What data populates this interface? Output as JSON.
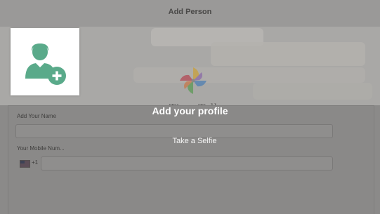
{
  "nav": {
    "title": "Add Person"
  },
  "banner": {
    "logo_text": "TippyTalk",
    "logo_icon": "pinwheel-logo-icon"
  },
  "avatar": {
    "icon": "add-person-icon",
    "accent_color": "#5aaa8a"
  },
  "form": {
    "name_label": "Add Your Name",
    "phone_label": "Your Mobile Num...",
    "country_code": "+1",
    "flag_icon": "us-flag-icon"
  },
  "overlay": {
    "title": "Add your profile",
    "action": "Take a Selfie"
  }
}
